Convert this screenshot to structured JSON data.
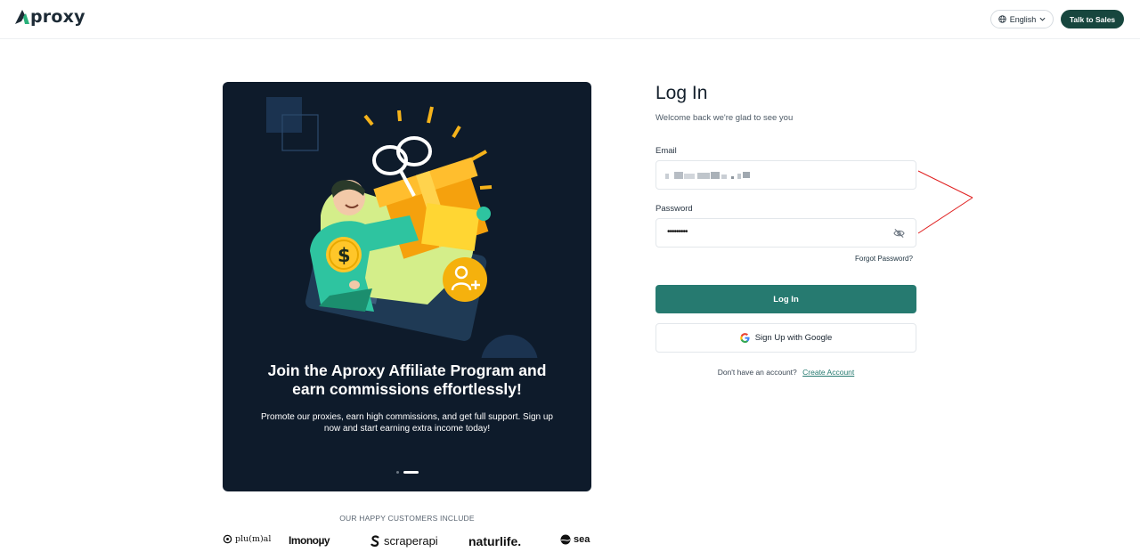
{
  "header": {
    "brand_initial": "A",
    "brand_rest": "proxy",
    "language": "English",
    "sales_label": "Talk to Sales"
  },
  "promo": {
    "title": "Join the Aproxy Affiliate Program and earn commissions effortlessly!",
    "description": "Promote our proxies, earn high commissions, and get full support. Sign up now and start earning extra income today!",
    "slides_total": 2,
    "active_slide": 2
  },
  "customers": {
    "title": "OUR HAPPY CUSTOMERS INCLUDE",
    "logos": [
      "plu(m)al",
      "Imonoµy",
      "scraperapi",
      "naturlife.",
      "sea"
    ]
  },
  "login": {
    "title": "Log In",
    "subtitle": "Welcome back we're glad to see you",
    "email_label": "Email",
    "email_value": "",
    "password_label": "Password",
    "password_mask": "•••••••••",
    "forgot_label": "Forgot Password?",
    "submit_label": "Log In",
    "google_label": "Sign Up with Google",
    "no_account_text": "Don't have an account?",
    "create_label": "Create Account"
  },
  "colors": {
    "brand_dark": "#17463e",
    "primary_button": "#267a70",
    "promo_bg": "#0e1b2b",
    "annotation": "#e02020"
  },
  "icons": [
    "globe-icon",
    "chevron-down-icon",
    "eye-off-icon",
    "google-icon",
    "gift-illustration"
  ]
}
